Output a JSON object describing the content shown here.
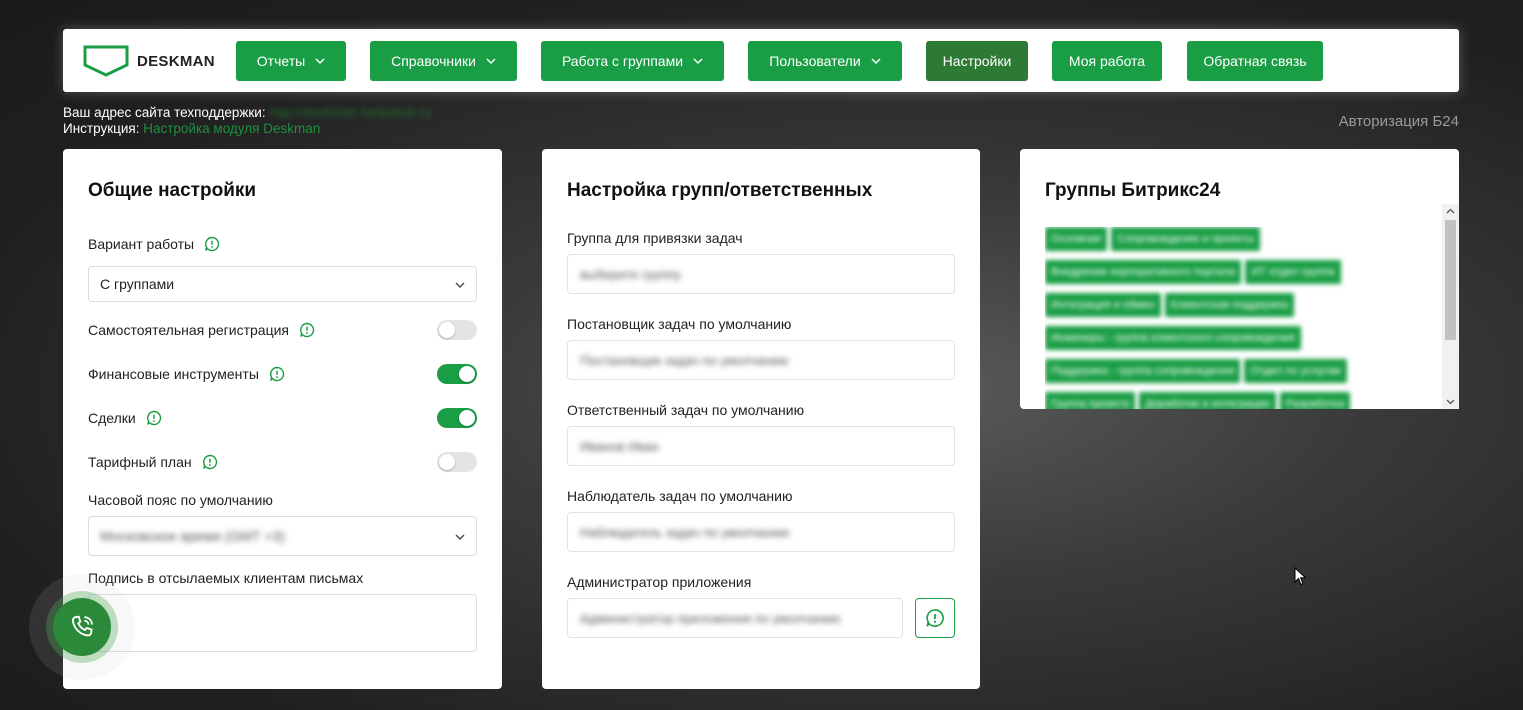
{
  "brand": {
    "name": "DESKMAN"
  },
  "nav": [
    {
      "label": "Отчеты",
      "dropdown": true
    },
    {
      "label": "Справочники",
      "dropdown": true
    },
    {
      "label": "Работа с группами",
      "dropdown": true
    },
    {
      "label": "Пользователи",
      "dropdown": true
    },
    {
      "label": "Настройки",
      "dropdown": false,
      "active": true
    },
    {
      "label": "Моя работа",
      "dropdown": false
    },
    {
      "label": "Обратная связь",
      "dropdown": false
    }
  ],
  "info": {
    "support_label": "Ваш адрес сайта техподдержки:",
    "support_value": "http://deskman.helpdesk.ru",
    "instruction_label": "Инструкция:",
    "instruction_link": "Настройка модуля Deskman",
    "auth_link": "Авторизация Б24"
  },
  "general": {
    "title": "Общие настройки",
    "work_mode_label": "Вариант работы",
    "work_mode_value": "С группами",
    "self_registration_label": "Самостоятельная регистрация",
    "self_registration_on": false,
    "finance_label": "Финансовые инструменты",
    "finance_on": true,
    "deals_label": "Сделки",
    "deals_on": true,
    "tariff_label": "Тарифный план",
    "tariff_on": false,
    "timezone_label": "Часовой пояс по умолчанию",
    "timezone_value": "Московское время (GMT +3)",
    "signature_label": "Подпись в отсылаемых клиентам письмах"
  },
  "groups_settings": {
    "title": "Настройка групп/ответственных",
    "task_group_label": "Группа для привязки задач",
    "task_group_value": "выберите группу",
    "creator_label": "Постановщик задач по умолчанию",
    "creator_value": "Постановщик задач по умолчанию",
    "responsible_label": "Ответственный задач по умолчанию",
    "responsible_value": "Иванов Иван",
    "observer_label": "Наблюдатель задач по умолчанию",
    "observer_value": "Наблюдатель задач по умолчанию",
    "admin_label": "Администратор приложения",
    "admin_value": "Администратор приложения по умолчанию"
  },
  "b24_groups": {
    "title": "Группы Битрикс24",
    "tags": [
      "Основная",
      "Сопровождение и проекты",
      "Внедрение корпоративного портала",
      "ИТ отдел группа",
      "Интеграция и обмен",
      "Клиентская поддержка",
      "Инженеры - группа клиентского сопровождения",
      "Поддержка - группа сопровождения",
      "Отдел по услугам",
      "Группа проекта",
      "Доработки и интеграции",
      "Разработка"
    ]
  },
  "colors": {
    "accent": "#1a9e45",
    "active": "#2d7a34"
  }
}
